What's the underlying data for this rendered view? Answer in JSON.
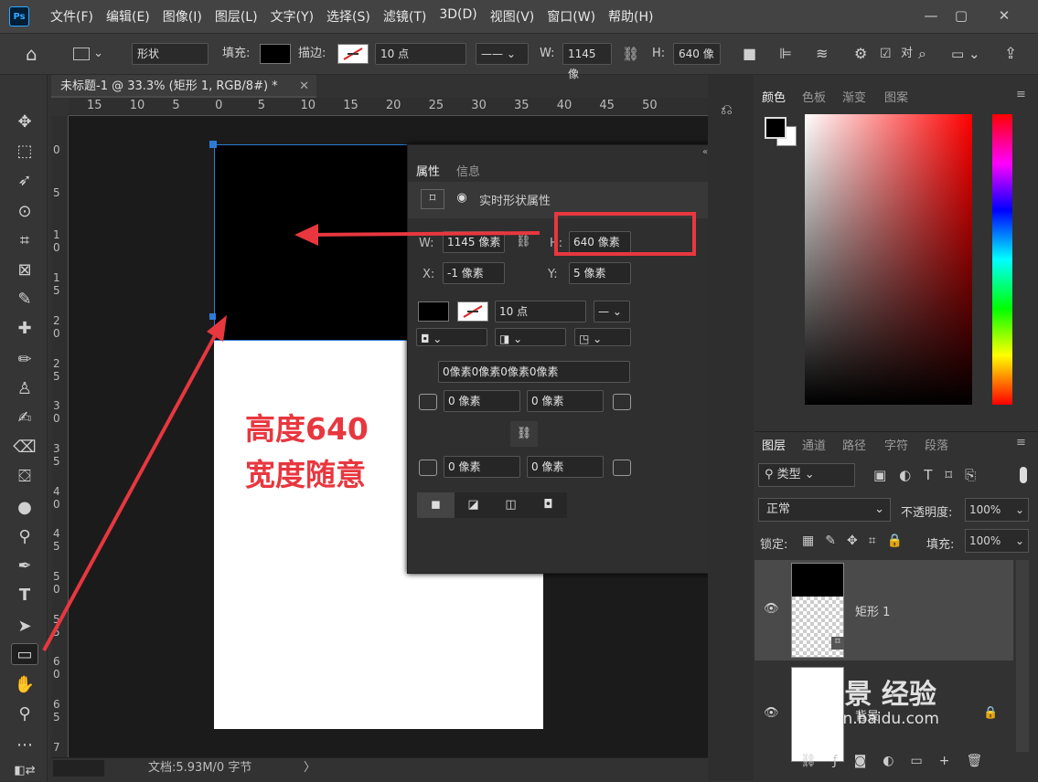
{
  "app": {
    "logo": "Ps"
  },
  "menu": [
    "文件(F)",
    "编辑(E)",
    "图像(I)",
    "图层(L)",
    "文字(Y)",
    "选择(S)",
    "滤镜(T)",
    "3D(D)",
    "视图(V)",
    "窗口(W)",
    "帮助(H)"
  ],
  "window_controls": {
    "minimize": "—",
    "restore": "▢",
    "close": "✕"
  },
  "options": {
    "mode": "形状",
    "fill_label": "填充:",
    "stroke_label": "描边:",
    "stroke_width": "10 点",
    "w_label": "W:",
    "w_value": "1145 像",
    "h_label": "H:",
    "h_value": "640 像",
    "align_edges": "对"
  },
  "document": {
    "tab_title": "未标题-1 @ 33.3% (矩形 1, RGB/8#) *",
    "hruler_ticks": [
      "15",
      "10",
      "5",
      "0",
      "5",
      "10",
      "15",
      "20",
      "25",
      "30",
      "35",
      "40",
      "45",
      "50"
    ],
    "vruler_ticks": [
      "0",
      "5",
      "1\n0",
      "1\n5",
      "2\n0",
      "2\n5",
      "3\n0",
      "3\n5",
      "4\n0",
      "4\n5",
      "5\n0",
      "5\n5",
      "6\n0",
      "6\n5",
      "7"
    ],
    "status": "文档:5.93M/0 字节"
  },
  "properties": {
    "tab_active": "属性",
    "tab_other": "信息",
    "section_title": "实时形状属性",
    "w_label": "W:",
    "w_value": "1145 像素",
    "h_label": "H:",
    "h_value": "640 像素",
    "x_label": "X:",
    "x_value": "-1 像素",
    "y_label": "Y:",
    "y_value": "5 像素",
    "stroke_width": "10 点",
    "corner_all": "0像素0像素0像素0像素",
    "corner_tl": "0 像素",
    "corner_tr": "0 像素",
    "corner_bl": "0 像素",
    "corner_br": "0 像素"
  },
  "color_panel": {
    "tabs": [
      "颜色",
      "色板",
      "渐变",
      "图案"
    ]
  },
  "layers_panel": {
    "tabs": [
      "图层",
      "通道",
      "路径",
      "字符",
      "段落"
    ],
    "filter": "类型",
    "blend_mode": "正常",
    "opacity_label": "不透明度:",
    "opacity_value": "100%",
    "lock_label": "锁定:",
    "fill_label": "填充:",
    "fill_value": "100%",
    "layers": [
      {
        "name": "矩形 1"
      },
      {
        "name": "背景"
      }
    ]
  },
  "annotations": {
    "line1": "高度640",
    "line2": "宽度随意",
    "watermark": "Bai景 经验",
    "watermark_url": "jingyan.baidu.com"
  }
}
